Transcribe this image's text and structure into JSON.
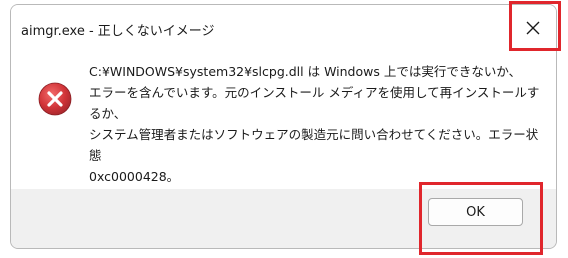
{
  "window": {
    "title": "aimgr.exe - 正しくないイメージ",
    "close_label": "✕"
  },
  "dialog": {
    "icon": "error-icon",
    "message": "C:¥WINDOWS¥system32¥slcpg.dll は Windows 上では実行できないか、\nエラーを含んでいます。元のインストール メディアを使用して再インストールするか、\nシステム管理者またはソフトウェアの製造元に問い合わせてください。エラー状態\n0xc0000428。"
  },
  "buttons": {
    "ok_label": "OK"
  },
  "colors": {
    "highlight": "#e0262c",
    "error_icon": "#d13438"
  }
}
